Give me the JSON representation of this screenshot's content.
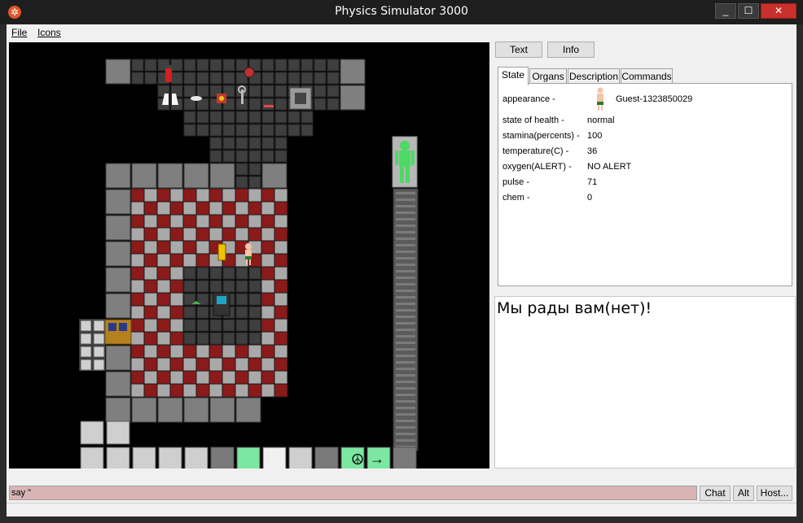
{
  "window": {
    "title": "Physics Simulator 3000",
    "buttons": [
      "_",
      "☐",
      "✕"
    ]
  },
  "menu": {
    "file": "File",
    "icons": "Icons"
  },
  "panel_buttons": {
    "text": "Text",
    "info": "Info"
  },
  "tabs": [
    {
      "label": "State",
      "active": true
    },
    {
      "label": "Organs",
      "active": false
    },
    {
      "label": "Description",
      "active": false
    },
    {
      "label": "Commands",
      "active": false
    }
  ],
  "state": {
    "appearance_label": "appearance -",
    "appearance_value": "Guest-1323850029",
    "rows": [
      {
        "label": "state of health -",
        "value": "normal"
      },
      {
        "label": "stamina(percents) -",
        "value": "100"
      },
      {
        "label": "temperature(C) -",
        "value": "36"
      },
      {
        "label": "oxygen(ALERT) -",
        "value": "NO ALERT"
      },
      {
        "label": "pulse -",
        "value": "71"
      },
      {
        "label": "chem -",
        "value": "0"
      }
    ]
  },
  "chat": {
    "message": "Мы рады вам(нет)!"
  },
  "input": {
    "say_value": "say \""
  },
  "bottom_buttons": {
    "chat": "Chat",
    "alt": "Alt",
    "host": "Host..."
  },
  "colors": {
    "floor_red": "#8b1a1a",
    "floor_grey": "#6b6b6b",
    "wall_grey": "#7f7f7f",
    "health_green": "#4cd964",
    "hud_green": "#7be7a0",
    "chat_input": "#d8b4b4"
  },
  "icons": [
    "app-icon",
    "fire-extinguisher-icon",
    "lab-coat-icon",
    "wrench-icon",
    "robot-icon",
    "computer-console-icon",
    "yellow-pda-icon",
    "human-figure-icon",
    "peace-icon",
    "arrow-right-icon",
    "ear-icon",
    "glove-icon",
    "helmet-icon",
    "armor-icon",
    "gas-mask-icon",
    "throw-icon"
  ]
}
